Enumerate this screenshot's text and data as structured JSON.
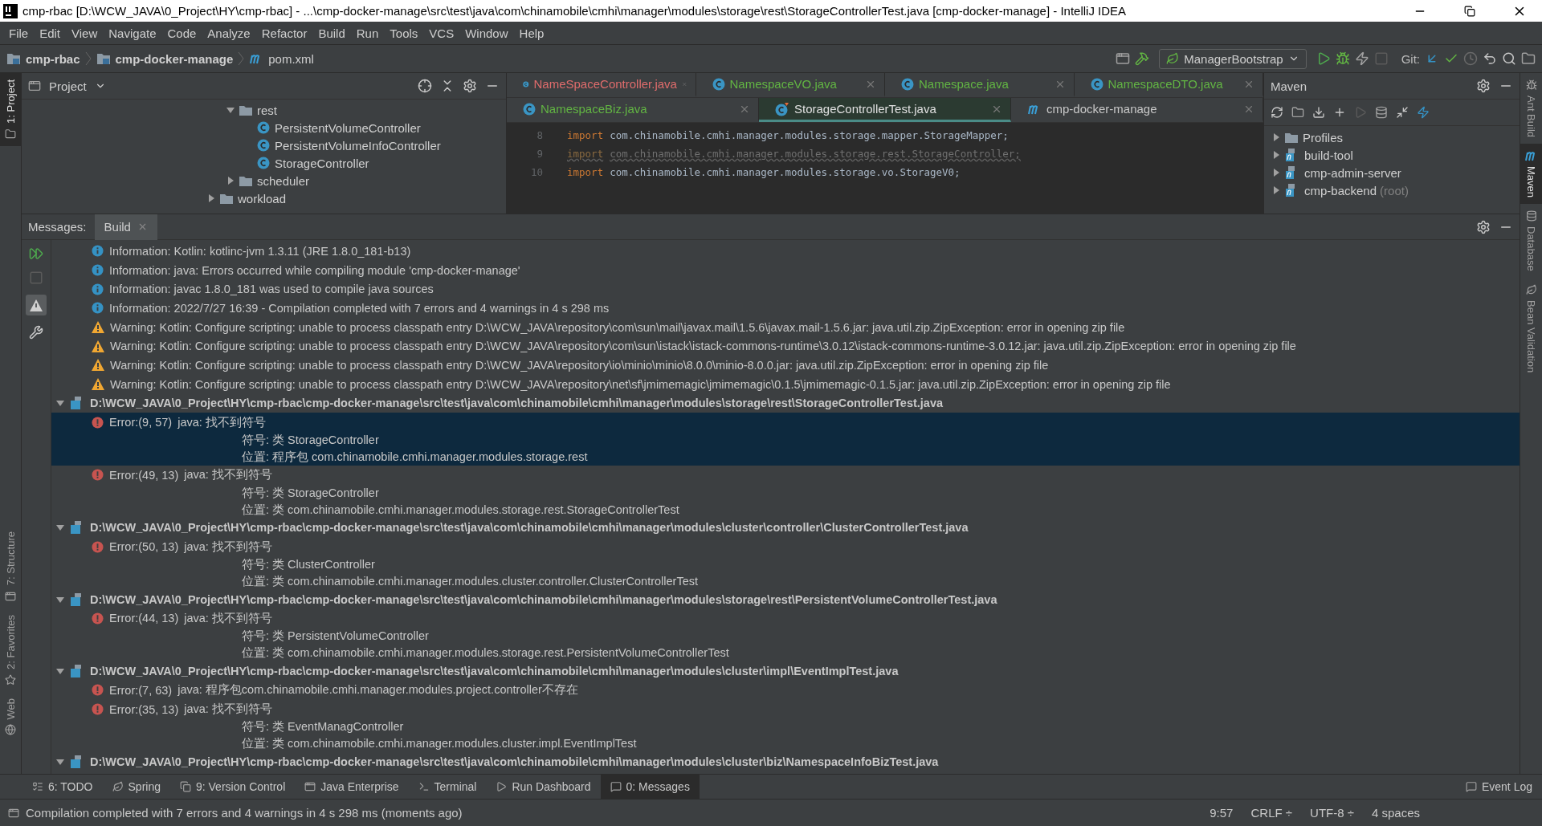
{
  "window": {
    "title": "cmp-rbac [D:\\WCW_JAVA\\0_Project\\HY\\cmp-rbac] - ...\\cmp-docker-manage\\src\\test\\java\\com\\chinamobile\\cmhi\\manager\\modules\\storage\\rest\\StorageControllerTest.java [cmp-docker-manage] - IntelliJ IDEA"
  },
  "menu": [
    "File",
    "Edit",
    "View",
    "Navigate",
    "Code",
    "Analyze",
    "Refactor",
    "Build",
    "Run",
    "Tools",
    "VCS",
    "Window",
    "Help"
  ],
  "breadcrumbs": [
    {
      "label": "cmp-rbac",
      "kind": "module"
    },
    {
      "label": "cmp-docker-manage",
      "kind": "module"
    },
    {
      "label": "pom.xml",
      "kind": "maven"
    }
  ],
  "run_config": "ManagerBootstrap",
  "git_label": "Git:",
  "left_stripe": [
    {
      "label": "1: Project",
      "selected": true,
      "kind": "folder"
    },
    {
      "label": "7: Structure",
      "selected": false,
      "kind": "structure"
    },
    {
      "label": "2: Favorites",
      "selected": false,
      "kind": "star"
    },
    {
      "label": "Web",
      "selected": false,
      "kind": "web"
    }
  ],
  "right_stripe": [
    {
      "label": "Ant Build",
      "selected": false,
      "kind": "ant"
    },
    {
      "label": "Maven",
      "selected": true,
      "kind": "maven"
    },
    {
      "label": "Database",
      "selected": false,
      "kind": "database"
    },
    {
      "label": "Bean Validation",
      "selected": false,
      "kind": "bean"
    }
  ],
  "project": {
    "title": "Project",
    "tree": [
      {
        "label": "rest",
        "kind": "folder",
        "expanded": true,
        "children": [
          {
            "label": "PersistentVolumeController",
            "kind": "class"
          },
          {
            "label": "PersistentVolumeInfoController",
            "kind": "class"
          },
          {
            "label": "StorageController",
            "kind": "class"
          }
        ]
      },
      {
        "label": "scheduler",
        "kind": "folder",
        "expanded": false
      },
      {
        "label": "workload",
        "kind": "folder",
        "expanded": false,
        "outdent": true
      }
    ]
  },
  "editor": {
    "tab_rows": [
      [
        {
          "label": "NameSpaceController.java",
          "color": "#e06c6c",
          "selected": false,
          "kind": "class"
        },
        {
          "label": "NamespaceVO.java",
          "color": "#62b543",
          "selected": false,
          "kind": "class"
        },
        {
          "label": "Namespace.java",
          "color": "#62b543",
          "selected": false,
          "kind": "class"
        },
        {
          "label": "NamespaceDTO.java",
          "color": "#62b543",
          "selected": false,
          "kind": "class"
        }
      ],
      [
        {
          "label": "NamespaceBiz.java",
          "color": "#62b543",
          "selected": false,
          "kind": "class"
        },
        {
          "label": "StorageControllerTest.java",
          "color": "#e0e0e0",
          "selected": true,
          "kind": "test"
        },
        {
          "label": "cmp-docker-manage",
          "color": "#c8c8c8",
          "selected": false,
          "kind": "maven"
        }
      ]
    ],
    "lines": [
      {
        "number": "8",
        "keyword": "import",
        "code": "com.chinamobile.cmhi.manager.modules.storage.mapper.StorageMapper;",
        "unused": false
      },
      {
        "number": "9",
        "keyword": "import",
        "code": "com.chinamobile.cmhi.manager.modules.storage.rest.StorageController;",
        "unused": true
      },
      {
        "number": "10",
        "keyword": "import",
        "code": "com.chinamobile.cmhi.manager.modules.storage.vo.StorageV0;",
        "unused": false
      }
    ]
  },
  "maven": {
    "title": "Maven",
    "tree": [
      {
        "label": "Profiles",
        "kind": "profiles"
      },
      {
        "label": "build-tool",
        "kind": "module"
      },
      {
        "label": "cmp-admin-server",
        "kind": "module"
      },
      {
        "label": "cmp-backend",
        "note": "(root)",
        "kind": "module"
      }
    ]
  },
  "messages": {
    "label": "Messages:",
    "tabs": [
      {
        "label": "Build",
        "selected": true
      }
    ],
    "notes": [
      {
        "kind": "info",
        "text": "Information: Kotlin: kotlinc-jvm 1.3.11 (JRE 1.8.0_181-b13)"
      },
      {
        "kind": "info",
        "text": "Information: java: Errors occurred while compiling module 'cmp-docker-manage'"
      },
      {
        "kind": "info",
        "text": "Information: javac 1.8.0_181 was used to compile java sources"
      },
      {
        "kind": "info",
        "text": "Information: 2022/7/27 16:39 - Compilation completed with 7 errors and 4 warnings in 4 s 298 ms"
      },
      {
        "kind": "warning",
        "text": "Warning: Kotlin: Configure scripting: unable to process classpath entry D:\\WCW_JAVA\\repository\\com\\sun\\mail\\javax.mail\\1.5.6\\javax.mail-1.5.6.jar: java.util.zip.ZipException: error in opening zip file"
      },
      {
        "kind": "warning",
        "text": "Warning: Kotlin: Configure scripting: unable to process classpath entry D:\\WCW_JAVA\\repository\\com\\sun\\istack\\istack-commons-runtime\\3.0.12\\istack-commons-runtime-3.0.12.jar: java.util.zip.ZipException: error in opening zip file"
      },
      {
        "kind": "warning",
        "text": "Warning: Kotlin: Configure scripting: unable to process classpath entry D:\\WCW_JAVA\\repository\\io\\minio\\minio\\8.0.0\\minio-8.0.0.jar: java.util.zip.ZipException: error in opening zip file"
      },
      {
        "kind": "warning",
        "text": "Warning: Kotlin: Configure scripting: unable to process classpath entry D:\\WCW_JAVA\\repository\\net\\sf\\jmimemagic\\jmimemagic\\0.1.5\\jmimemagic-0.1.5.jar: java.util.zip.ZipException: error in opening zip file"
      }
    ],
    "files": [
      {
        "path": "D:\\WCW_JAVA\\0_Project\\HY\\cmp-rbac\\cmp-docker-manage\\src\\test\\java\\com\\chinamobile\\cmhi\\manager\\modules\\storage\\rest\\StorageControllerTest.java",
        "expanded": true,
        "errors": [
          {
            "position": "Error:(9, 57)",
            "message": "java: 找不到符号",
            "selected": true,
            "details": [
              "符号:   类 StorageController",
              "位置: 程序包 com.chinamobile.cmhi.manager.modules.storage.rest"
            ]
          },
          {
            "position": "Error:(49, 13)",
            "message": "java: 找不到符号",
            "selected": false,
            "details": [
              "符号:   类 StorageController",
              "位置: 类 com.chinamobile.cmhi.manager.modules.storage.rest.StorageControllerTest"
            ]
          }
        ]
      },
      {
        "path": "D:\\WCW_JAVA\\0_Project\\HY\\cmp-rbac\\cmp-docker-manage\\src\\test\\java\\com\\chinamobile\\cmhi\\manager\\modules\\cluster\\controller\\ClusterControllerTest.java",
        "expanded": true,
        "errors": [
          {
            "position": "Error:(50, 13)",
            "message": "java: 找不到符号",
            "selected": false,
            "details": [
              "符号:   类 ClusterController",
              "位置: 类 com.chinamobile.cmhi.manager.modules.cluster.controller.ClusterControllerTest"
            ]
          }
        ]
      },
      {
        "path": "D:\\WCW_JAVA\\0_Project\\HY\\cmp-rbac\\cmp-docker-manage\\src\\test\\java\\com\\chinamobile\\cmhi\\manager\\modules\\storage\\rest\\PersistentVolumeControllerTest.java",
        "expanded": true,
        "errors": [
          {
            "position": "Error:(44, 13)",
            "message": "java: 找不到符号",
            "selected": false,
            "details": [
              "符号:   类 PersistentVolumeController",
              "位置: 类 com.chinamobile.cmhi.manager.modules.storage.rest.PersistentVolumeControllerTest"
            ]
          }
        ]
      },
      {
        "path": "D:\\WCW_JAVA\\0_Project\\HY\\cmp-rbac\\cmp-docker-manage\\src\\test\\java\\com\\chinamobile\\cmhi\\manager\\modules\\cluster\\impl\\EventImplTest.java",
        "expanded": true,
        "errors": [
          {
            "position": "Error:(7, 63)",
            "message": "java: 程序包com.chinamobile.cmhi.manager.modules.project.controller不存在",
            "selected": false
          },
          {
            "position": "Error:(35, 13)",
            "message": "java: 找不到符号",
            "selected": false,
            "details": [
              "符号:   类 EventManagController",
              "位置: 类 com.chinamobile.cmhi.manager.modules.cluster.impl.EventImplTest"
            ]
          }
        ]
      },
      {
        "path": "D:\\WCW_JAVA\\0_Project\\HY\\cmp-rbac\\cmp-docker-manage\\src\\test\\java\\com\\chinamobile\\cmhi\\manager\\modules\\cluster\\biz\\NamespaceInfoBizTest.java",
        "expanded": true
      }
    ]
  },
  "bottom_tabs": [
    {
      "label": "6: TODO",
      "kind": "todo",
      "selected": false
    },
    {
      "label": "Spring",
      "kind": "spring",
      "selected": false
    },
    {
      "label": "9: Version Control",
      "kind": "vcs",
      "selected": false
    },
    {
      "label": "Java Enterprise",
      "kind": "enterprise",
      "selected": false
    },
    {
      "label": "Terminal",
      "kind": "terminal",
      "selected": false
    },
    {
      "label": "Run Dashboard",
      "kind": "run",
      "selected": false
    },
    {
      "label": "0: Messages",
      "kind": "messages",
      "selected": true
    }
  ],
  "event_log": "Event Log",
  "status_bar": {
    "message": "Compilation completed with 7 errors and 4 warnings in 4 s 298 ms (moments ago)",
    "items": [
      "9:57",
      "CRLF ÷",
      "UTF-8 ÷",
      "4 spaces"
    ]
  }
}
